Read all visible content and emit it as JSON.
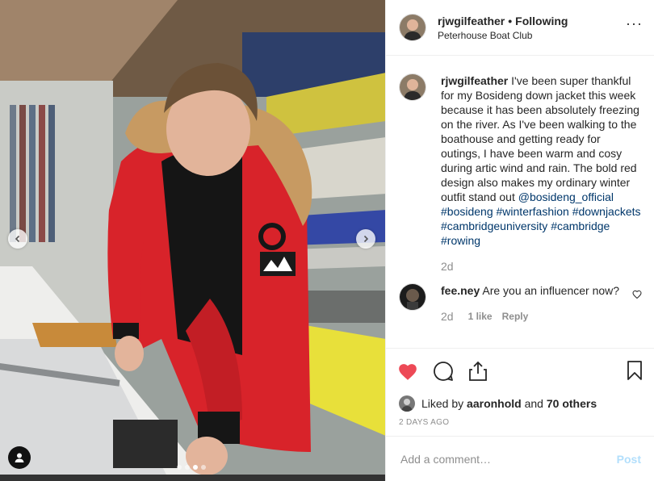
{
  "post": {
    "author": "rjwgilfeather",
    "separator": "•",
    "follow_status": "Following",
    "location": "Peterhouse Boat Club",
    "more_icon": "more-options-icon"
  },
  "caption": {
    "username": "rjwgilfeather",
    "text": "I've been super thankful for my Bosideng down jacket this week because it has been absolutely freezing on the river. As I've been walking to the boathouse and getting ready for outings, I have been warm and cosy during artic wind and rain. The bold red design also makes my ordinary winter outfit stand out ",
    "mention": "@bosideng_official",
    "hashtags": [
      "#bosideng",
      "#winterfashion",
      "#downjackets",
      "#cambridgeuniversity",
      "#cambridge",
      "#rowing"
    ],
    "time": "2d"
  },
  "comment": {
    "username": "fee.ney",
    "text": "Are you an influencer now?",
    "time": "2d",
    "likes": "1 like",
    "reply_label": "Reply"
  },
  "likes": {
    "prefix": "Liked by",
    "user": "aaronhold",
    "conjunction": "and",
    "others": "70 others"
  },
  "timestamp": "2 DAYS AGO",
  "add_comment": {
    "placeholder": "Add a comment…",
    "post_label": "Post"
  },
  "carousel": {
    "slide_count": 4,
    "active_index": 2
  },
  "colors": {
    "liked_heart": "#ed4956",
    "link": "#00376b",
    "post_button_disabled": "#b2dffc",
    "jacket_red": "#d8232a"
  }
}
